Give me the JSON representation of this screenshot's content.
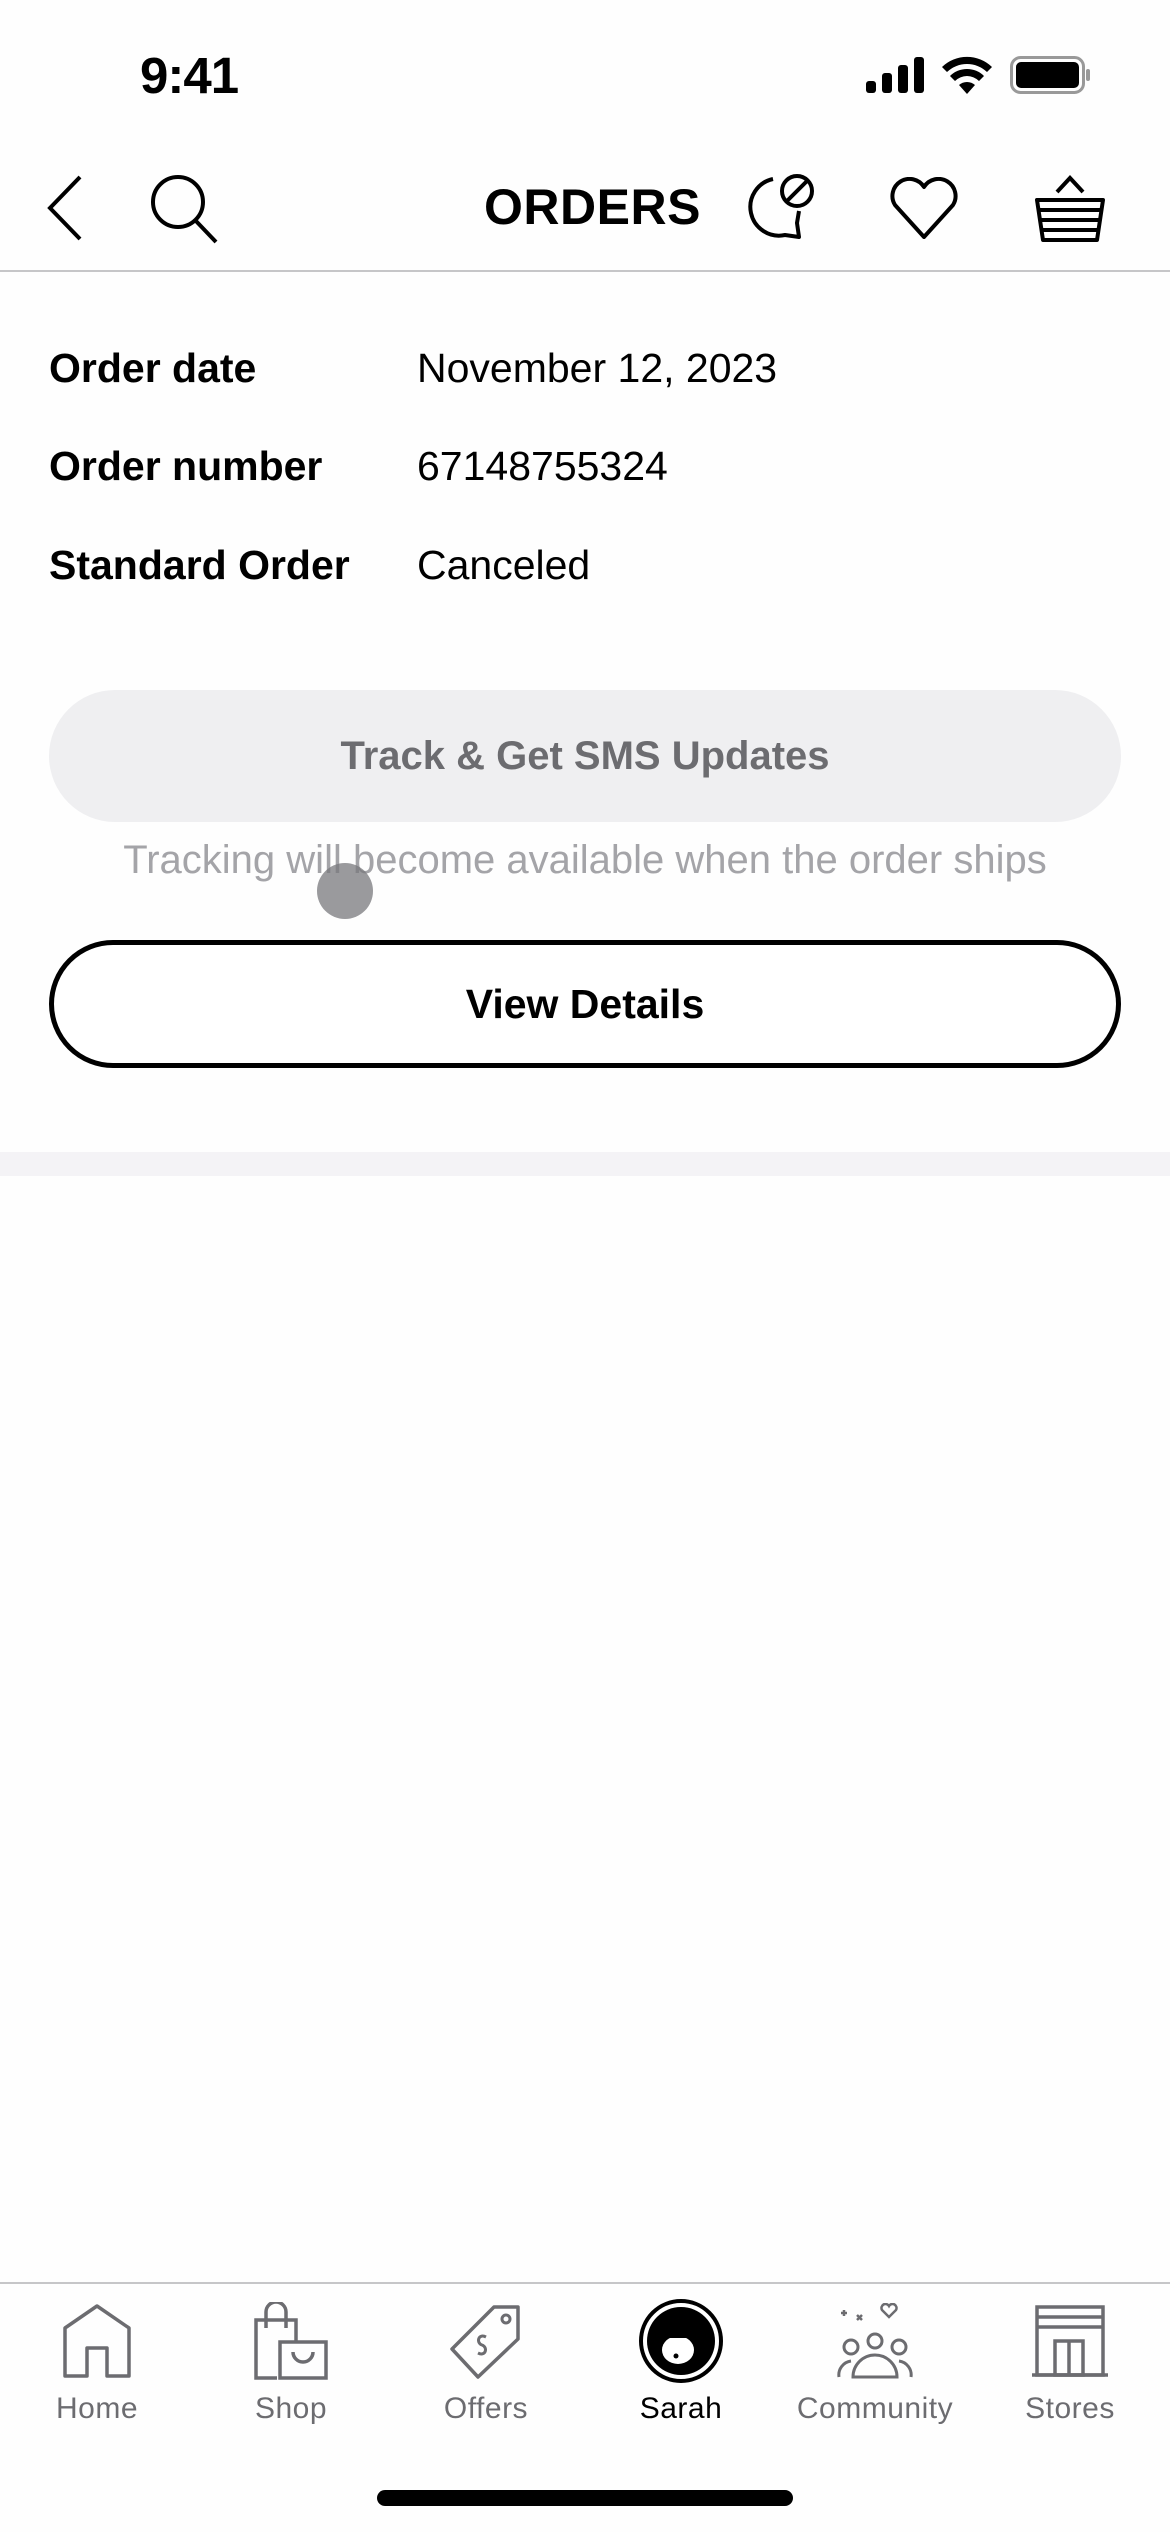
{
  "status_bar": {
    "time": "9:41",
    "icons": [
      "cellular-signal-icon",
      "wifi-icon",
      "battery-icon"
    ]
  },
  "header": {
    "title": "ORDERS",
    "left_icons": [
      "back-chevron-icon",
      "search-icon"
    ],
    "right_icons": [
      "chat-bubble-icon",
      "heart-icon",
      "basket-icon"
    ]
  },
  "order": {
    "rows": [
      {
        "label": "Order date",
        "value": "November 12, 2023"
      },
      {
        "label": "Order number",
        "value": "67148755324"
      },
      {
        "label": "Standard Order",
        "value": "Canceled"
      }
    ],
    "track_button_label": "Track & Get SMS Updates",
    "track_note": "Tracking will become available when the order ships",
    "details_button_label": "View Details"
  },
  "tabbar": {
    "active": "Sarah",
    "items": [
      {
        "label": "Home",
        "icon": "home-icon"
      },
      {
        "label": "Shop",
        "icon": "shopping-bags-icon"
      },
      {
        "label": "Offers",
        "icon": "price-tag-icon"
      },
      {
        "label": "Sarah",
        "icon": "avatar-icon"
      },
      {
        "label": "Community",
        "icon": "community-icon"
      },
      {
        "label": "Stores",
        "icon": "storefront-icon"
      }
    ]
  },
  "colors": {
    "text_primary": "#000000",
    "text_secondary": "#6c6c70",
    "disabled_button_bg": "#efeff1",
    "note_text": "#a4a4a8",
    "separator": "#f4f3f6"
  }
}
